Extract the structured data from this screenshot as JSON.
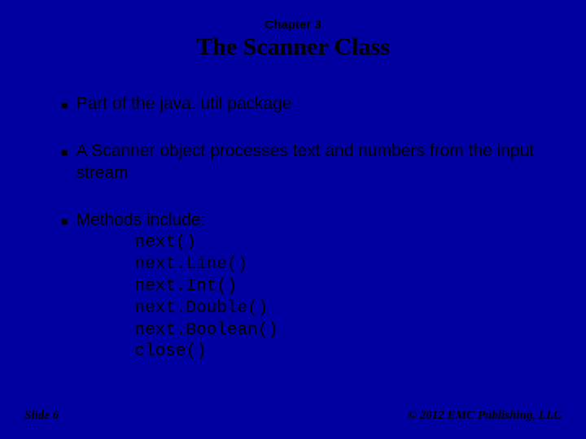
{
  "header": {
    "chapter": "Chapter 3",
    "title": "The Scanner Class"
  },
  "bullets": {
    "item0": "Part of the java. util package",
    "item1": "A Scanner object processes text and numbers from the input stream",
    "item2": "Methods include:"
  },
  "methods": {
    "m0": "next()",
    "m1": "next.Line()",
    "m2": "next.Int()",
    "m3": "next.Double()",
    "m4": "next.Boolean()",
    "m5": "close()"
  },
  "footer": {
    "slide": "Slide 6",
    "copyright": "© 2012 EMC Publishing, LLC"
  }
}
